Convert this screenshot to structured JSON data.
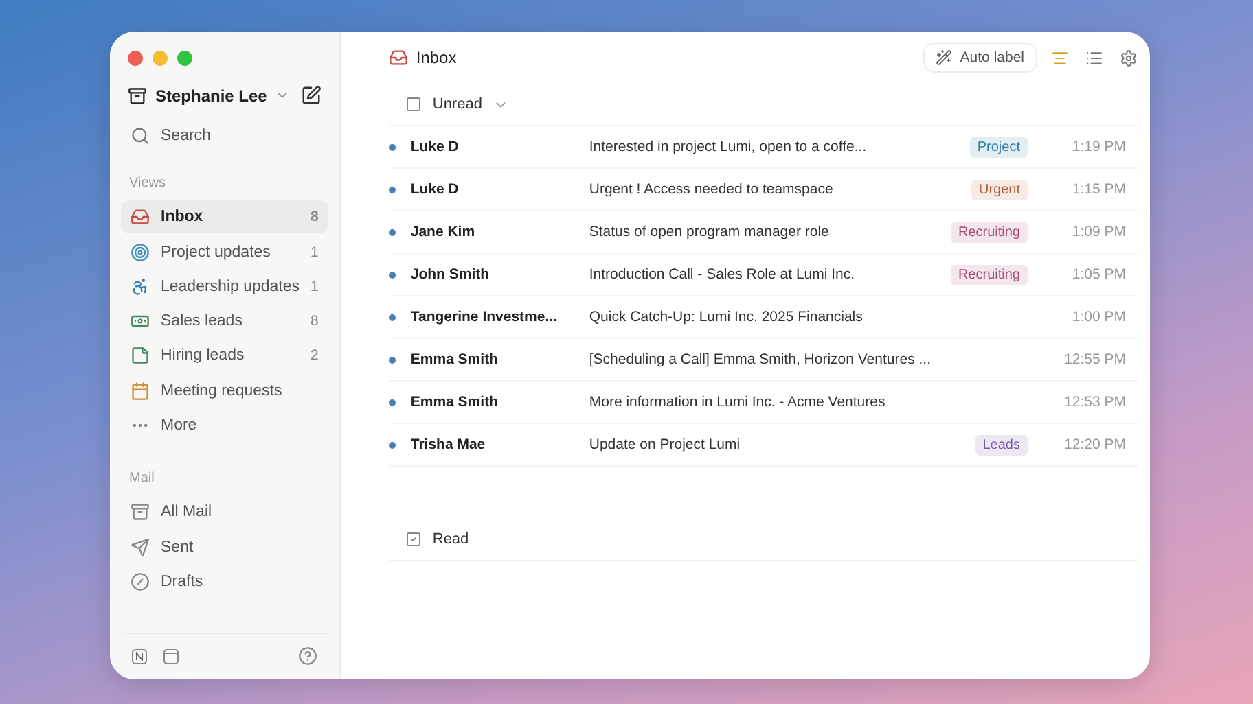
{
  "account": {
    "name": "Stephanie Lee"
  },
  "search": {
    "label": "Search"
  },
  "views": {
    "heading": "Views",
    "items": [
      {
        "label": "Inbox",
        "count": "8",
        "selected": true
      },
      {
        "label": "Project updates",
        "count": "1",
        "selected": false
      },
      {
        "label": "Leadership updates",
        "count": "1",
        "selected": false
      },
      {
        "label": "Sales leads",
        "count": "8",
        "selected": false
      },
      {
        "label": "Hiring leads",
        "count": "2",
        "selected": false
      },
      {
        "label": "Meeting requests",
        "selected": false
      },
      {
        "label": "More",
        "selected": false
      }
    ]
  },
  "mail": {
    "heading": "Mail",
    "items": [
      {
        "label": "All Mail",
        "selected": false
      },
      {
        "label": "Sent",
        "selected": false
      },
      {
        "label": "Drafts",
        "selected": false
      }
    ]
  },
  "header": {
    "title": "Inbox",
    "auto_label": "Auto label"
  },
  "groups": [
    {
      "label": "Unread",
      "checked": false,
      "rows": [
        {
          "sender": "Luke D",
          "subject": "Interested in project Lumi, open to a coffe...",
          "tag": {
            "text": "Project",
            "color": "#2f7fa8"
          },
          "time": "1:19 PM",
          "unread": true
        },
        {
          "sender": "Luke D",
          "subject": "Urgent ! Access needed to teamspace",
          "tag": {
            "text": "Urgent",
            "color": "#b8623a"
          },
          "time": "1:15 PM",
          "unread": true
        },
        {
          "sender": "Jane Kim",
          "subject": "Status of open program manager role",
          "tag": {
            "text": "Recruiting",
            "color": "#a84a78"
          },
          "time": "1:09 PM",
          "unread": true
        },
        {
          "sender": "John Smith",
          "subject": "Introduction Call - Sales Role at Lumi Inc.",
          "tag": {
            "text": "Recruiting",
            "color": "#a84a78"
          },
          "time": "1:05 PM",
          "unread": true
        },
        {
          "sender": "Tangerine Investme...",
          "subject": "Quick Catch-Up: Lumi Inc. 2025 Financials",
          "time": "1:00 PM",
          "unread": true
        },
        {
          "sender": "Emma Smith",
          "subject": "[Scheduling a Call] Emma Smith, Horizon Ventures ...",
          "time": "12:55 PM",
          "unread": true
        },
        {
          "sender": "Emma Smith",
          "subject": "More information in Lumi Inc. - Acme Ventures",
          "time": "12:53 PM",
          "unread": true
        },
        {
          "sender": "Trisha Mae",
          "subject": "Update on Project Lumi",
          "tag": {
            "text": "Leads",
            "color": "#7a5aa8"
          },
          "time": "12:20 PM",
          "unread": true
        }
      ]
    },
    {
      "label": "Read",
      "checked": true
    }
  ]
}
